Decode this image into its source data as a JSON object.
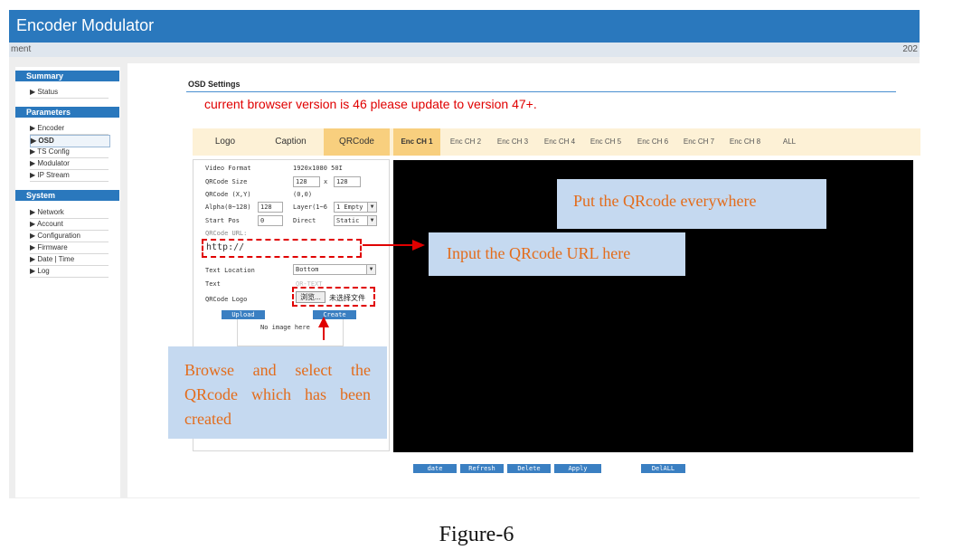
{
  "header": {
    "title": "Encoder Modulator"
  },
  "subbar": {
    "left": "ment",
    "right": "202"
  },
  "sidebar": {
    "sections": [
      {
        "title": "Summary",
        "items": [
          "Status"
        ]
      },
      {
        "title": "Parameters",
        "items": [
          "Encoder",
          "OSD",
          "TS Config",
          "Modulator",
          "IP Stream"
        ]
      },
      {
        "title": "System",
        "items": [
          "Network",
          "Account",
          "Configuration",
          "Firmware",
          "Date | Time",
          "Log"
        ]
      }
    ],
    "active_item": "OSD",
    "arrow": "▶"
  },
  "osd": {
    "title": "OSD Settings",
    "warning": "current browser version is 46 please update to version 47+.",
    "tabs": [
      "Logo",
      "Caption",
      "QRCode"
    ],
    "active_tab": "QRCode",
    "channels": [
      "Enc CH 1",
      "Enc CH 2",
      "Enc CH 3",
      "Enc CH 4",
      "Enc CH 5",
      "Enc CH 6",
      "Enc CH 7",
      "Enc CH 8",
      "ALL"
    ],
    "active_channel": "Enc CH 1"
  },
  "form": {
    "video_format_label": "Video Format",
    "video_format_value": "1920x1080 50I",
    "qrcode_size_label": "QRCode Size",
    "qrcode_size_w": "128",
    "qrcode_size_x": "x",
    "qrcode_size_h": "128",
    "qrcode_xy_label": "QRCode (X,Y)",
    "qrcode_xy_value": "(0,0)",
    "alpha_label": "Alpha(0~128)",
    "alpha_value": "128",
    "layer_label": "Layer(1~6",
    "layer_value": "1 Empty",
    "start_pos_label": "Start Pos",
    "start_pos_value": "0",
    "direct_label": "Direct",
    "direct_value": "Static",
    "url_label": "QRCode URL:",
    "url_value": "http://",
    "text_location_label": "Text Location",
    "text_location_value": "Bottom",
    "text_label": "Text",
    "text_value": "QR-TEXT",
    "logo_label": "QRCode Logo",
    "browse_label": "浏览...",
    "no_file_label": "未选择文件",
    "upload_label": "Upload",
    "create_label": "Create",
    "no_image_label": "No image here"
  },
  "bottom_buttons": [
    "date",
    "Refresh",
    "Delete",
    "Apply",
    "DelALL"
  ],
  "annotations": {
    "put_qr": "Put the QRcode everywhere",
    "input_url": "Input the QRcode URL here",
    "browse_select": "Browse and select the QRcode which has been created"
  },
  "figure_caption": "Figure-6",
  "colors": {
    "brand_blue": "#2a78bd",
    "warning_red": "#e00000",
    "tab_active": "#f8cf7e",
    "callout_bg": "#c5d9f0",
    "callout_text": "#e36c1b"
  }
}
